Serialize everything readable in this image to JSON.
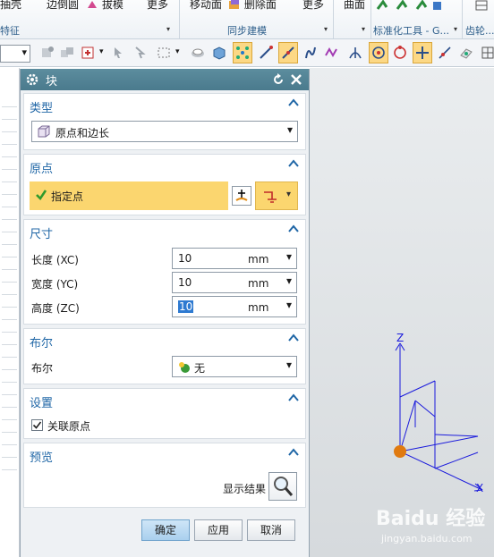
{
  "ribbon": {
    "top_items": [
      "抽壳",
      "边倒圆",
      "拔模",
      "更多",
      "移动面",
      "删除面",
      "更多",
      "曲面"
    ],
    "groups": [
      "特征",
      "同步建模",
      "标准化工具 - G...",
      "齿轮..."
    ]
  },
  "dialog": {
    "title": "块",
    "type_section": {
      "title": "类型",
      "value": "原点和边长"
    },
    "origin_section": {
      "title": "原点",
      "point_label": "指定点"
    },
    "size_section": {
      "title": "尺寸",
      "rows": [
        {
          "label": "长度 (XC)",
          "value": "10",
          "unit": "mm"
        },
        {
          "label": "宽度 (YC)",
          "value": "10",
          "unit": "mm"
        },
        {
          "label": "高度 (ZC)",
          "value": "10",
          "unit": "mm"
        }
      ]
    },
    "boolean_section": {
      "title": "布尔",
      "label": "布尔",
      "value": "无"
    },
    "settings_section": {
      "title": "设置",
      "checkbox_label": "关联原点",
      "checked": true
    },
    "preview_section": {
      "title": "预览",
      "show_result_label": "显示结果"
    },
    "buttons": {
      "ok": "确定",
      "apply": "应用",
      "cancel": "取消"
    }
  },
  "viewport": {
    "axis_z": "Z",
    "axis_x": "X",
    "axis_color": "#1a1adc",
    "origin_color": "#e07a10"
  },
  "watermark": {
    "main": "Baidu 经验",
    "sub": "jingyan.baidu.com"
  }
}
